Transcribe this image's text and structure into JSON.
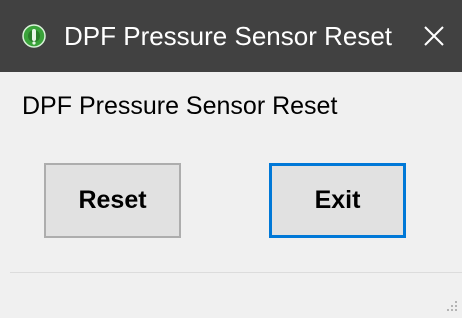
{
  "window": {
    "title": "DPF Pressure Sensor Reset",
    "titlebar_color": "#414141",
    "icon": "app-globe-icon",
    "close_icon": "close-icon"
  },
  "body": {
    "label": "DPF Pressure Sensor Reset"
  },
  "buttons": {
    "reset_label": "Reset",
    "exit_label": "Exit"
  },
  "colors": {
    "client_background": "#f0f0f0",
    "button_background": "#e1e1e1",
    "focus_border": "#0078d7"
  },
  "statusbar": {
    "grip_icon": "resize-grip-icon"
  }
}
